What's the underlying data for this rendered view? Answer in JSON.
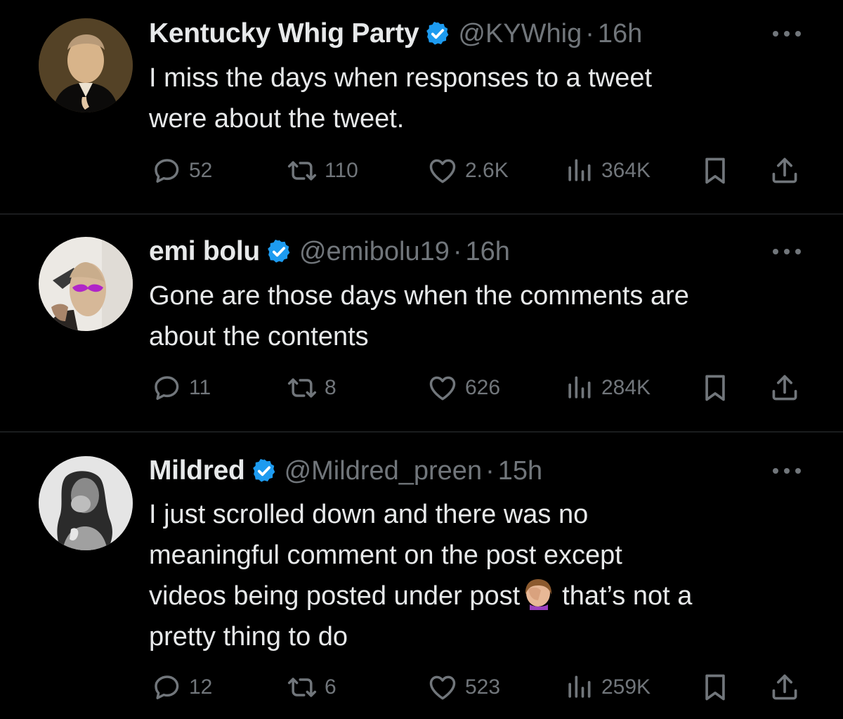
{
  "colors": {
    "background": "#000000",
    "text": "#e7e9ea",
    "secondary": "#71767b",
    "verified": "#1d9bf0",
    "divider": "#2f3336"
  },
  "tweets": [
    {
      "name": "Kentucky Whig Party",
      "handle": "@KYWhig",
      "separator": "·",
      "time": "16h",
      "text_lines": [
        "I miss the days when responses to a tweet",
        "were about the tweet."
      ],
      "replies": "52",
      "retweets": "110",
      "likes": "2.6K",
      "views": "364K"
    },
    {
      "name": "emi bolu",
      "handle": "@emibolu19",
      "separator": "·",
      "time": "16h",
      "text_lines": [
        "Gone are those days when the comments are",
        "about the contents"
      ],
      "replies": "11",
      "retweets": "8",
      "likes": "626",
      "views": "284K"
    },
    {
      "name": "Mildred",
      "handle": "@Mildred_preen",
      "separator": "·",
      "time": "15h",
      "text_lines": [
        "I just scrolled down and there was no",
        "meaningful comment on the post except"
      ],
      "text_line3_before": "videos being posted under post",
      "emoji_icon": "face-palm-emoji",
      "text_line3_after": "that’s not a",
      "text_line4": "pretty thing to do",
      "replies": "12",
      "retweets": "6",
      "likes": "523",
      "views": "259K"
    }
  ]
}
